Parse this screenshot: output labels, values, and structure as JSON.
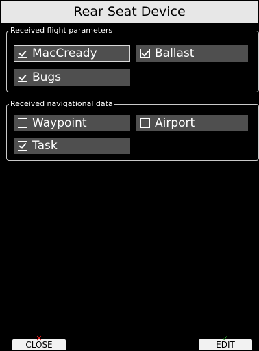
{
  "window": {
    "title": "Rear Seat Device"
  },
  "flight_params": {
    "legend": "Received flight parameters",
    "options": [
      {
        "label": "MacCready",
        "checked": true,
        "selected": true
      },
      {
        "label": "Ballast",
        "checked": true,
        "selected": false
      },
      {
        "label": "Bugs",
        "checked": true,
        "selected": false
      }
    ]
  },
  "nav_data": {
    "legend": "Received navigational data",
    "options": [
      {
        "label": "Waypoint",
        "checked": false,
        "selected": false
      },
      {
        "label": "Airport",
        "checked": false,
        "selected": false
      },
      {
        "label": "Task",
        "checked": true,
        "selected": false
      }
    ]
  },
  "soft_keys": {
    "close": {
      "label": "CLOSE",
      "icon": "x-icon"
    },
    "edit": {
      "label": "EDIT",
      "icon": "check-icon"
    }
  },
  "colors": {
    "background": "#000000",
    "title_bar": "#e7e7e7",
    "option_bg": "#4f4f4f",
    "close_icon": "#e02020",
    "edit_icon": "#2faa2f"
  }
}
